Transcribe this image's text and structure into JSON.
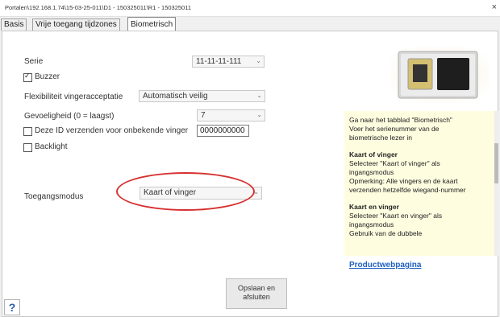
{
  "window": {
    "title": "Portalen\\192.168.1.74\\15-03-25-011\\D1 - 150325011\\R1 - 150325011",
    "close_glyph": "×"
  },
  "tabs": [
    {
      "label": "Basis"
    },
    {
      "label": "Vrije toegang tijdzones"
    },
    {
      "label": "Biometrisch"
    }
  ],
  "form": {
    "serie_label": "Serie",
    "serie_value": "11-11-11-111",
    "buzzer_label": "Buzzer",
    "buzzer_checked": true,
    "flex_label": "Flexibiliteit vingeracceptatie",
    "flex_value": "Automatisch veilig",
    "sens_label": "Gevoeligheid (0 = laagst)",
    "sens_value": "7",
    "sendid_label": "Deze ID verzenden voor onbekende vinger",
    "sendid_value": "0000000000",
    "backlight_label": "Backlight",
    "mode_label": "Toegangsmodus",
    "mode_value": "Kaart of vinger"
  },
  "help": {
    "intro": [
      "Ga naar het tabblad \"Biometrisch\"",
      "Voer het serienummer van de",
      "biometrische lezer in"
    ],
    "s1_title": "Kaart of vinger",
    "s1_lines": [
      "Selecteer \"Kaart of vinger\" als",
      "ingangsmodus",
      "Opmerking: Alle vingers en de kaart",
      "verzenden hetzelfde wiegand-nummer"
    ],
    "s2_title": "Kaart en vinger",
    "s2_lines": [
      "Selecteer \"Kaart en vinger\" als",
      "ingangsmodus",
      "Gebruik van de dubbele"
    ]
  },
  "product_link": "Productwebpagina",
  "save_button": [
    "Opslaan en",
    "afsluiten"
  ],
  "help_button": "?",
  "colors": {
    "accent_link": "#2060c0",
    "highlight_ellipse": "#d83030",
    "help_bg": "#fffde0"
  }
}
